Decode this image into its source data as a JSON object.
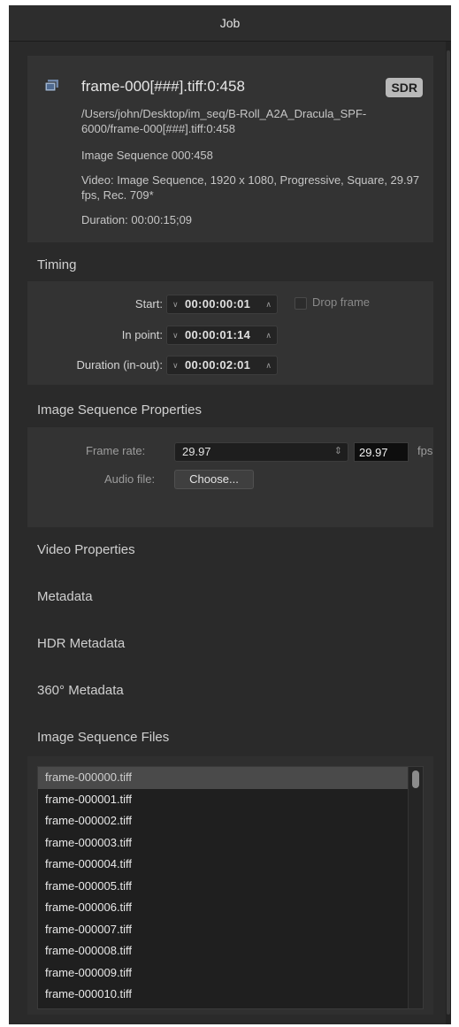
{
  "window": {
    "title": "Job"
  },
  "source": {
    "filename": "frame-000[###].tiff:0:458",
    "badge": "SDR",
    "path": "/Users/john/Desktop/im_seq/B-Roll_A2A_Dracula_SPF-6000/frame-000[###].tiff:0:458",
    "sequence": "Image Sequence 000:458",
    "video": "Video: Image Sequence, 1920 x 1080, Progressive, Square, 29.97 fps, Rec. 709*",
    "duration": "Duration: 00:00:15;09",
    "icon": "film-stack-icon"
  },
  "timing": {
    "title": "Timing",
    "start_label": "Start:",
    "start_value": "00:00:00:01",
    "drop_frame_label": "Drop frame",
    "drop_frame_checked": false,
    "in_point_label": "In point:",
    "in_point_value": "00:00:01:14",
    "duration_label": "Duration (in-out):",
    "duration_value": "00:00:02:01"
  },
  "image_sequence_properties": {
    "title": "Image Sequence Properties",
    "frame_rate_label": "Frame rate:",
    "frame_rate_selected": "29.97",
    "frame_rate_value": "29.97",
    "fps_unit": "fps",
    "audio_file_label": "Audio file:",
    "choose_label": "Choose..."
  },
  "collapsed_sections": {
    "video_properties": "Video Properties",
    "metadata": "Metadata",
    "hdr_metadata": "HDR Metadata",
    "metadata_360": "360° Metadata"
  },
  "image_sequence_files": {
    "title": "Image Sequence Files",
    "selected_index": 0,
    "files": [
      "frame-000000.tiff",
      "frame-000001.tiff",
      "frame-000002.tiff",
      "frame-000003.tiff",
      "frame-000004.tiff",
      "frame-000005.tiff",
      "frame-000006.tiff",
      "frame-000007.tiff",
      "frame-000008.tiff",
      "frame-000009.tiff",
      "frame-000010.tiff"
    ]
  },
  "colors": {
    "panel_bg": "#2a2a2a",
    "card_bg": "#333333",
    "badge_bg": "#b9b9b9",
    "selected_row": "#4a4a4a"
  }
}
